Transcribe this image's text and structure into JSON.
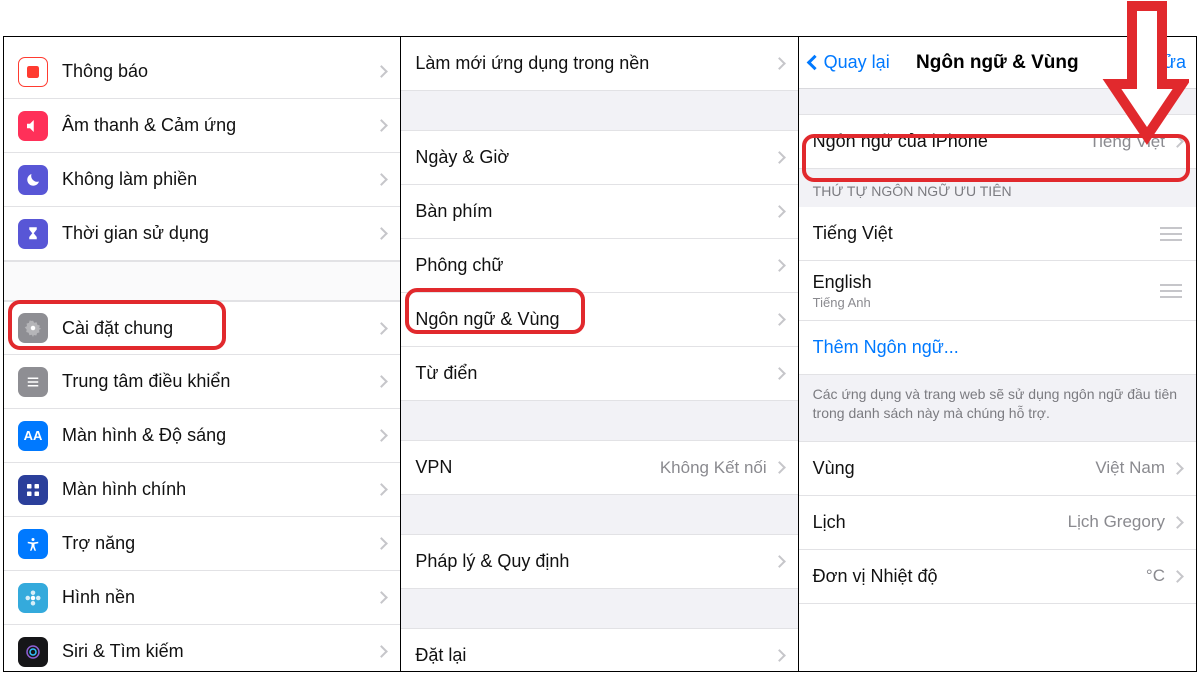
{
  "pane1": {
    "items": [
      {
        "icon": "notification",
        "bg": "#ff3b30",
        "label": "Thông báo"
      },
      {
        "icon": "speaker",
        "bg": "#ff2d55",
        "label": "Âm thanh & Cảm ứng"
      },
      {
        "icon": "moon",
        "bg": "#5856d6",
        "label": "Không làm phiền"
      },
      {
        "icon": "hourglass",
        "bg": "#5856d6",
        "label": "Thời gian sử dụng"
      },
      {
        "icon": "gear",
        "bg": "#8e8e93",
        "label": "Cài đặt chung"
      },
      {
        "icon": "sliders",
        "bg": "#8e8e93",
        "label": "Trung tâm điều khiển"
      },
      {
        "icon": "aa",
        "bg": "#0079ff",
        "label": "Màn hình & Độ sáng"
      },
      {
        "icon": "grid",
        "bg": "#2b3f9b",
        "label": "Màn hình chính"
      },
      {
        "icon": "accessibility",
        "bg": "#0079ff",
        "label": "Trợ năng"
      },
      {
        "icon": "flower",
        "bg": "#34aadc",
        "label": "Hình nền"
      },
      {
        "icon": "siri",
        "bg": "#161618",
        "label": "Siri & Tìm kiếm"
      }
    ]
  },
  "pane2": {
    "top": [
      {
        "label": "Làm mới ứng dụng trong nền"
      }
    ],
    "group1": [
      {
        "label": "Ngày & Giờ"
      },
      {
        "label": "Bàn phím"
      },
      {
        "label": "Phông chữ"
      },
      {
        "label": "Ngôn ngữ & Vùng"
      },
      {
        "label": "Từ điển"
      }
    ],
    "group2": [
      {
        "label": "VPN",
        "detail": "Không Kết nối"
      }
    ],
    "group3": [
      {
        "label": "Pháp lý & Quy định"
      }
    ],
    "group4": [
      {
        "label": "Đặt lại"
      }
    ]
  },
  "pane3": {
    "nav": {
      "back": "Quay lại",
      "title": "Ngôn ngữ & Vùng",
      "edit": "Sửa"
    },
    "iphoneLang": {
      "label": "Ngôn ngữ của iPhone",
      "value": "Tiếng Việt"
    },
    "prefHeader": "THỨ TỰ NGÔN NGỮ ƯU TIÊN",
    "langs": [
      {
        "name": "Tiếng Việt",
        "sub": ""
      },
      {
        "name": "English",
        "sub": "Tiếng Anh"
      }
    ],
    "addLang": "Thêm Ngôn ngữ...",
    "footnote": "Các ứng dụng và trang web sẽ sử dụng ngôn ngữ đầu tiên trong danh sách này mà chúng hỗ trợ.",
    "region": {
      "label": "Vùng",
      "value": "Việt Nam"
    },
    "calendar": {
      "label": "Lịch",
      "value": "Lịch Gregory"
    },
    "temp": {
      "label": "Đơn vị Nhiệt độ",
      "value": "°C"
    }
  }
}
